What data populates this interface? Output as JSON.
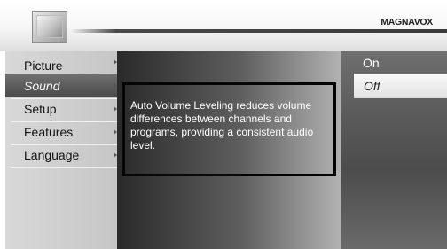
{
  "header": {
    "brand": "MAGNAVOX",
    "icon": "tv-icon"
  },
  "menu": {
    "items": [
      {
        "label": "Picture",
        "selected": false
      },
      {
        "label": "Sound",
        "selected": true
      },
      {
        "label": "Setup",
        "selected": false
      },
      {
        "label": "Features",
        "selected": false
      },
      {
        "label": "Language",
        "selected": false
      }
    ]
  },
  "help": {
    "text": "Auto Volume Leveling reduces volume differences between channels and programs, providing a consistent audio level."
  },
  "options": {
    "items": [
      {
        "label": "On",
        "selected": false
      },
      {
        "label": "Off",
        "selected": true
      }
    ]
  },
  "colors": {
    "menu_bg": "#c8c8c8",
    "menu_selected": "#5a5a5a",
    "help_border": "#050505"
  }
}
